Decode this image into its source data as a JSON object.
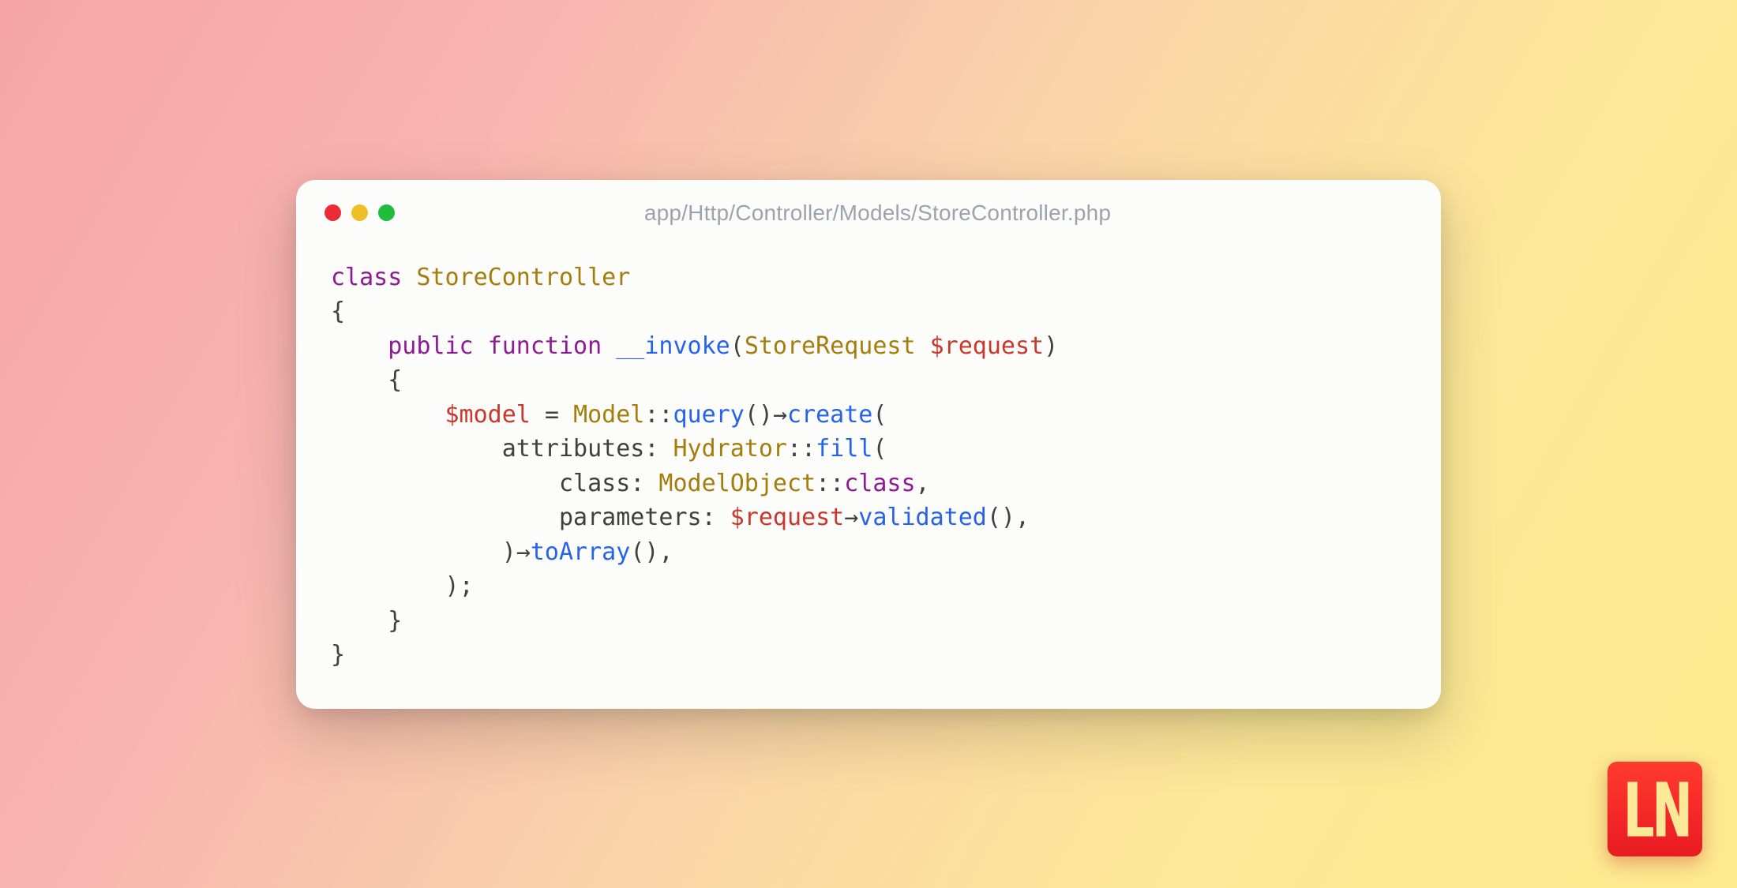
{
  "window": {
    "title": "app/Http/Controller/Models/StoreController.php",
    "traffic_lights": {
      "red": "#ec2b38",
      "yellow": "#f0be25",
      "green": "#20bc3c"
    }
  },
  "code": {
    "tokens": {
      "class_kw": "class",
      "class_name": "StoreController",
      "open_brace": "{",
      "public_kw": "public",
      "function_kw": "function",
      "method_name": "__invoke",
      "param_type": "StoreRequest",
      "param_var": "$request",
      "model_var": "$model",
      "eq": "=",
      "model_class": "Model",
      "dcolon": "::",
      "query": "query",
      "arrow": "→",
      "create": "create",
      "attributes_label": "attributes:",
      "hydrator": "Hydrator",
      "fill": "fill",
      "class_label": "class:",
      "model_object": "ModelObject",
      "class_const": "class",
      "parameters_label": "parameters:",
      "request_var": "$request",
      "validated": "validated",
      "toarray": "toArray",
      "close_brace": "}",
      "semi": ";",
      "comma": ",",
      "lparen": "(",
      "rparen": ")"
    }
  },
  "logo": {
    "text": "LN",
    "bg": "#ef2b24"
  }
}
